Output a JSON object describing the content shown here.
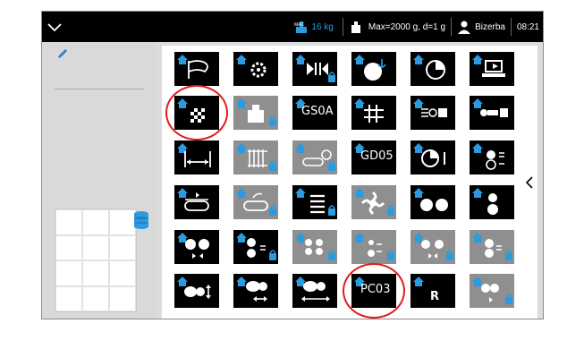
{
  "status_bar": {
    "scale_label": "16 kg",
    "max_label": "Max=2000 g, d=1 g",
    "user": "Bizerba",
    "time": "08:21"
  },
  "tiles": [
    {
      "name": "flag",
      "gray": false
    },
    {
      "name": "gear-cycle",
      "gray": false
    },
    {
      "name": "converge",
      "gray": false,
      "lock": true
    },
    {
      "name": "anchor-ball",
      "gray": false
    },
    {
      "name": "pie",
      "gray": false
    },
    {
      "name": "monitor",
      "gray": false
    },
    {
      "name": "checker-box",
      "gray": false,
      "highlight": true
    },
    {
      "name": "weight",
      "gray": true,
      "lock": true
    },
    {
      "name": "gs0a",
      "gray": false,
      "label": "GS0A"
    },
    {
      "name": "grid-hash",
      "gray": false
    },
    {
      "name": "sensor-box",
      "gray": false
    },
    {
      "name": "rod-box",
      "gray": false
    },
    {
      "name": "width-adjust",
      "gray": false
    },
    {
      "name": "cage",
      "gray": true,
      "lock": true
    },
    {
      "name": "conveyor-gear",
      "gray": true,
      "lock": true
    },
    {
      "name": "gd05",
      "gray": false,
      "label": "GD05"
    },
    {
      "name": "dial-bar",
      "gray": false
    },
    {
      "name": "timer-dots",
      "gray": false
    },
    {
      "name": "conveyor-forward",
      "gray": false
    },
    {
      "name": "conveyor-turn",
      "gray": true,
      "lock": true
    },
    {
      "name": "list-lines",
      "gray": false,
      "lock": true
    },
    {
      "name": "fan",
      "gray": true,
      "lock": true
    },
    {
      "name": "two-balls",
      "gray": false
    },
    {
      "name": "dot-stack",
      "gray": false
    },
    {
      "name": "ball-converge",
      "gray": false
    },
    {
      "name": "ball-adjust",
      "gray": false,
      "lock": true
    },
    {
      "name": "balls-converge",
      "gray": true,
      "lock": true
    },
    {
      "name": "ball-step",
      "gray": true,
      "lock": true
    },
    {
      "name": "balls-pair",
      "gray": true,
      "lock": true
    },
    {
      "name": "ball-adjust-2",
      "gray": true,
      "lock": true
    },
    {
      "name": "ball-height",
      "gray": false
    },
    {
      "name": "ball-width",
      "gray": false
    },
    {
      "name": "ball-length",
      "gray": false
    },
    {
      "name": "pc03",
      "gray": false,
      "label": "PC03",
      "highlight": true
    },
    {
      "name": "reset",
      "gray": false,
      "label": "R"
    },
    {
      "name": "balls-step",
      "gray": true,
      "lock": true
    }
  ]
}
